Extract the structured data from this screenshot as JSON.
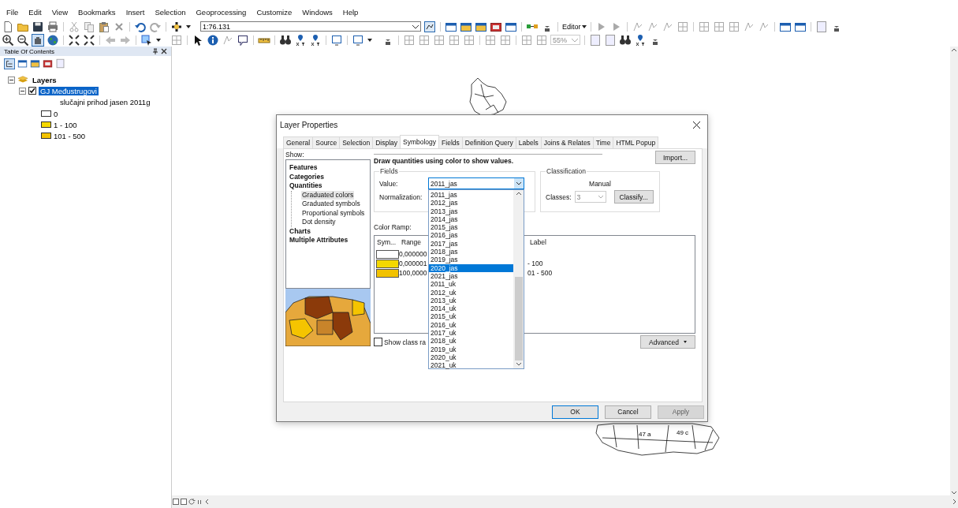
{
  "menu": [
    "File",
    "Edit",
    "View",
    "Bookmarks",
    "Insert",
    "Selection",
    "Geoprocessing",
    "Customize",
    "Windows",
    "Help"
  ],
  "toolbar": {
    "scale": "1:76.131",
    "editor": "Editor",
    "zoom": "55%"
  },
  "toc": {
    "title": "Table Of Contents",
    "tree": [
      {
        "kind": "data_frame",
        "label": "Layers",
        "expanded": true,
        "selected": false,
        "children": [
          {
            "kind": "layer",
            "label": "GJ Međustrugovi",
            "expanded": true,
            "checked": true,
            "selected": true,
            "field": "slučajni prihod jasen 2011g",
            "legend": [
              {
                "label": "0",
                "color": "#ffffff"
              },
              {
                "label": "1 - 100",
                "color": "#f5d800"
              },
              {
                "label": "101 - 500",
                "color": "#f2c200"
              }
            ]
          }
        ]
      }
    ]
  },
  "map": {
    "labels": [
      "47 a",
      "49 c"
    ]
  },
  "dialog": {
    "title": "Layer Properties",
    "tabs": [
      {
        "label": "General",
        "selected": false
      },
      {
        "label": "Source",
        "selected": false
      },
      {
        "label": "Selection",
        "selected": false
      },
      {
        "label": "Display",
        "selected": false
      },
      {
        "label": "Symbology",
        "selected": true
      },
      {
        "label": "Fields",
        "selected": false
      },
      {
        "label": "Definition Query",
        "selected": false
      },
      {
        "label": "Labels",
        "selected": false
      },
      {
        "label": "Joins & Relates",
        "selected": false
      },
      {
        "label": "Time",
        "selected": false
      },
      {
        "label": "HTML Popup",
        "selected": false
      }
    ],
    "show_label": "Show:",
    "show_items": [
      {
        "label": "Features",
        "selected": false
      },
      {
        "label": "Categories",
        "selected": false
      },
      {
        "label": "Quantities",
        "selected": false,
        "children": [
          {
            "label": "Graduated colors",
            "selected": true
          },
          {
            "label": "Graduated symbols",
            "selected": false
          },
          {
            "label": "Proportional symbols",
            "selected": false
          },
          {
            "label": "Dot density",
            "selected": false
          }
        ]
      },
      {
        "label": "Charts",
        "selected": false
      },
      {
        "label": "Multiple Attributes",
        "selected": false
      }
    ],
    "description": "Draw quantities using color to show values.",
    "import_button": "Import...",
    "fields": {
      "title": "Fields",
      "value_label": "Value:",
      "value": "2011_jas",
      "normalization_label": "Normalization:"
    },
    "classification": {
      "title": "Classification",
      "method": "Manual",
      "classes_label": "Classes:",
      "classes": "3",
      "classify_button": "Classify..."
    },
    "color_ramp_label": "Color Ramp:",
    "table": {
      "columns": [
        "Sym...",
        "Range",
        "Label"
      ],
      "rows": [
        {
          "color": "#ffffff",
          "range": "0,000000"
        },
        {
          "color": "#f5d800",
          "range": "0,000001",
          "label": "- 100"
        },
        {
          "color": "#f2c200",
          "range": "100,0000",
          "label": "01 - 500"
        }
      ]
    },
    "show_class_ranges": {
      "label": "Show class ra",
      "checked": false
    },
    "advanced_button": "Advanced",
    "dropdown": {
      "items": [
        {
          "label": "2011_jas",
          "selected": false
        },
        {
          "label": "2012_jas",
          "selected": false
        },
        {
          "label": "2013_jas",
          "selected": false
        },
        {
          "label": "2014_jas",
          "selected": false
        },
        {
          "label": "2015_jas",
          "selected": false
        },
        {
          "label": "2016_jas",
          "selected": false
        },
        {
          "label": "2017_jas",
          "selected": false
        },
        {
          "label": "2018_jas",
          "selected": false
        },
        {
          "label": "2019_jas",
          "selected": false
        },
        {
          "label": "2020_jas",
          "selected": true
        },
        {
          "label": "2021_jas",
          "selected": false
        },
        {
          "label": "2011_uk",
          "selected": false
        },
        {
          "label": "2012_uk",
          "selected": false
        },
        {
          "label": "2013_uk",
          "selected": false
        },
        {
          "label": "2014_uk",
          "selected": false
        },
        {
          "label": "2015_uk",
          "selected": false
        },
        {
          "label": "2016_uk",
          "selected": false
        },
        {
          "label": "2017_uk",
          "selected": false
        },
        {
          "label": "2018_uk",
          "selected": false
        },
        {
          "label": "2019_uk",
          "selected": false
        },
        {
          "label": "2020_uk",
          "selected": false
        },
        {
          "label": "2021_uk",
          "selected": false
        }
      ]
    },
    "buttons": [
      {
        "label": "OK",
        "default": true,
        "disabled": false
      },
      {
        "label": "Cancel",
        "default": false,
        "disabled": false
      },
      {
        "label": "Apply",
        "default": false,
        "disabled": true
      }
    ]
  }
}
